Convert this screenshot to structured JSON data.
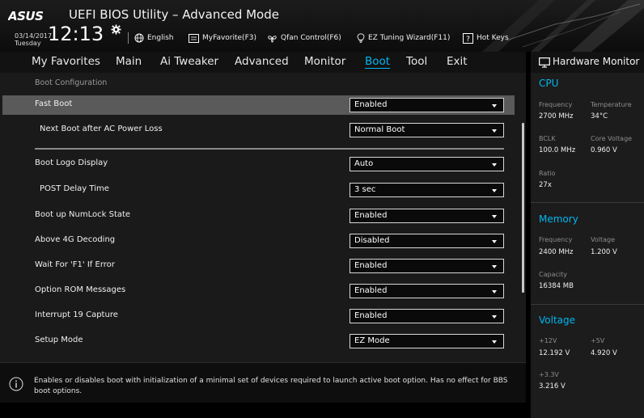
{
  "header": {
    "brand": "ASUS",
    "title": "UEFI BIOS Utility – Advanced Mode",
    "date": "03/14/2017",
    "day": "Tuesday",
    "time": "12:13",
    "toolbar": [
      {
        "label": "English",
        "icon": "globe-icon"
      },
      {
        "label": "MyFavorite(F3)",
        "icon": "favorite-list-icon"
      },
      {
        "label": "Qfan Control(F6)",
        "icon": "fan-icon"
      },
      {
        "label": "EZ Tuning Wizard(F11)",
        "icon": "lightbulb-icon"
      },
      {
        "label": "Hot Keys",
        "icon": "help-key-icon"
      }
    ]
  },
  "menu": {
    "tabs": [
      "My Favorites",
      "Main",
      "Ai Tweaker",
      "Advanced",
      "Monitor",
      "Boot",
      "Tool",
      "Exit"
    ],
    "active": "Boot"
  },
  "main": {
    "section_title": "Boot Configuration",
    "rows": [
      {
        "label": "Fast Boot",
        "value": "Enabled"
      },
      {
        "label": "Next Boot after AC Power Loss",
        "value": "Normal Boot"
      },
      {
        "label": "Boot Logo Display",
        "value": "Auto"
      },
      {
        "label": "POST Delay Time",
        "value": "3 sec"
      },
      {
        "label": "Boot up NumLock State",
        "value": "Enabled"
      },
      {
        "label": "Above 4G Decoding",
        "value": "Disabled"
      },
      {
        "label": "Wait For 'F1' If Error",
        "value": "Enabled"
      },
      {
        "label": "Option ROM Messages",
        "value": "Enabled"
      },
      {
        "label": "Interrupt 19 Capture",
        "value": "Enabled"
      },
      {
        "label": "Setup Mode",
        "value": "EZ Mode"
      }
    ],
    "selected_row": "Fast Boot"
  },
  "help": {
    "text": "Enables or disables boot with initialization of a minimal set of devices required to launch active boot option. Has no effect for BBS boot options."
  },
  "hardware_monitor": {
    "title": "Hardware Monitor",
    "cpu": {
      "title": "CPU",
      "frequency_label": "Frequency",
      "frequency": "2700 MHz",
      "temperature_label": "Temperature",
      "temperature": "34°C",
      "bclk_label": "BCLK",
      "bclk": "100.0 MHz",
      "core_voltage_label": "Core Voltage",
      "core_voltage": "0.960 V",
      "ratio_label": "Ratio",
      "ratio": "27x"
    },
    "memory": {
      "title": "Memory",
      "frequency_label": "Frequency",
      "frequency": "2400 MHz",
      "voltage_label": "Voltage",
      "voltage": "1.200 V",
      "capacity_label": "Capacity",
      "capacity": "16384 MB"
    },
    "voltage": {
      "title": "Voltage",
      "v12_label": "+12V",
      "v12": "12.192 V",
      "v5_label": "+5V",
      "v5": "4.920 V",
      "v33_label": "+3.3V",
      "v33": "3.216 V"
    }
  },
  "colors": {
    "accent": "#00b7f0",
    "selected_row": "#5a5a5a",
    "panel": "#1a1a1a"
  }
}
